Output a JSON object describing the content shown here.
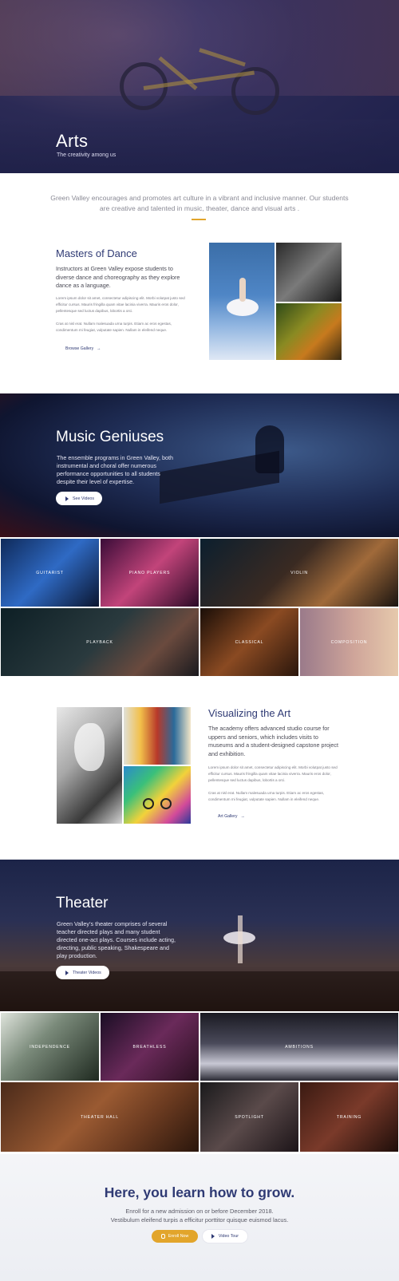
{
  "hero": {
    "title": "Arts",
    "subtitle": "The creativity among us"
  },
  "intro": {
    "text": "Green Valley encourages and promotes art culture in a vibrant and inclusive manner. Our students are creative and talented in music, theater, dance and visual arts ."
  },
  "dance": {
    "title": "Masters of Dance",
    "lead": "Instructors at Green Valley expose students to diverse dance and choreography as they explore dance as a language.",
    "body1": "Lorem ipsum dolor sit amet, consectetur adipiscing elit. Morbi volutpat justo sed efficitur cursus. Mauris fringilla quam vitae lacinia viverra. Mauris eros dolor, pellentesque sed luctus dapibus, lobortis a orci.",
    "body2": "Cras at nisl erat. Nullam malesuada urna turpis. Etiam ac eros egestas, condimentum mi feugiat, vulputate sapien. Nullam in eleifend neque.",
    "link": "Browse Gallery",
    "link_arrow": "→"
  },
  "music": {
    "title": "Music Geniuses",
    "text": "The ensemble programs in Green Valley, both instrumental and choral offer numerous performance opportunities to all students despite their level of expertise.",
    "button": "See Videos",
    "tiles": [
      "GUITARIST",
      "PIANO PLAYERS",
      "VIOLIN",
      "PLAYBACK",
      "CLASSICAL",
      "COMPOSITION"
    ]
  },
  "visual": {
    "title": "Visualizing the Art",
    "lead": "The academy offers advanced studio course for uppers and seniors, which includes visits to museums and a student-designed capstone project and exhibition.",
    "body1": "Lorem ipsum dolor sit amet, consectetur adipiscing elit. Morbi volutpat justo sed efficitur cursus. Mauris fringilla quam vitae lacinia viverra. Mauris eros dolor, pellentesque sed luctus dapibus, lobortis a orci.",
    "body2": "Cras at nisl erat. Nullam malesuada urna turpis. Etiam ac eros egestas, condimentum mi feugiat, vulputate sapien. Nullam in eleifend neque.",
    "link": "Art Gallery",
    "link_arrow": "→"
  },
  "theater": {
    "title": "Theater",
    "text": "Green Valley’s theater comprises of several teacher directed plays and many student directed one-act plays. Courses include acting, directing, public speaking, Shakespeare and play production.",
    "button": "Theater Videos",
    "tiles": [
      "INDEPENDENCE",
      "BREATHLESS",
      "AMBITIONS",
      "THEATER HALL",
      "SPOTLIGHT",
      "TRAINING"
    ]
  },
  "cta": {
    "title": "Here, you learn how to grow.",
    "line1": "Enroll for a new admission on or before December 2018.",
    "line2": "Vestibulum eleifend turpis a efficitur porttitor quisque euismod lacus.",
    "enroll": "Enroll Now",
    "tour": "Video Tour"
  },
  "colors": {
    "accent": "#e2a52b",
    "brand": "#2f3a74"
  },
  "icons": {
    "play": "play-icon",
    "arrow": "arrow-right-icon",
    "hand": "hand-icon"
  }
}
